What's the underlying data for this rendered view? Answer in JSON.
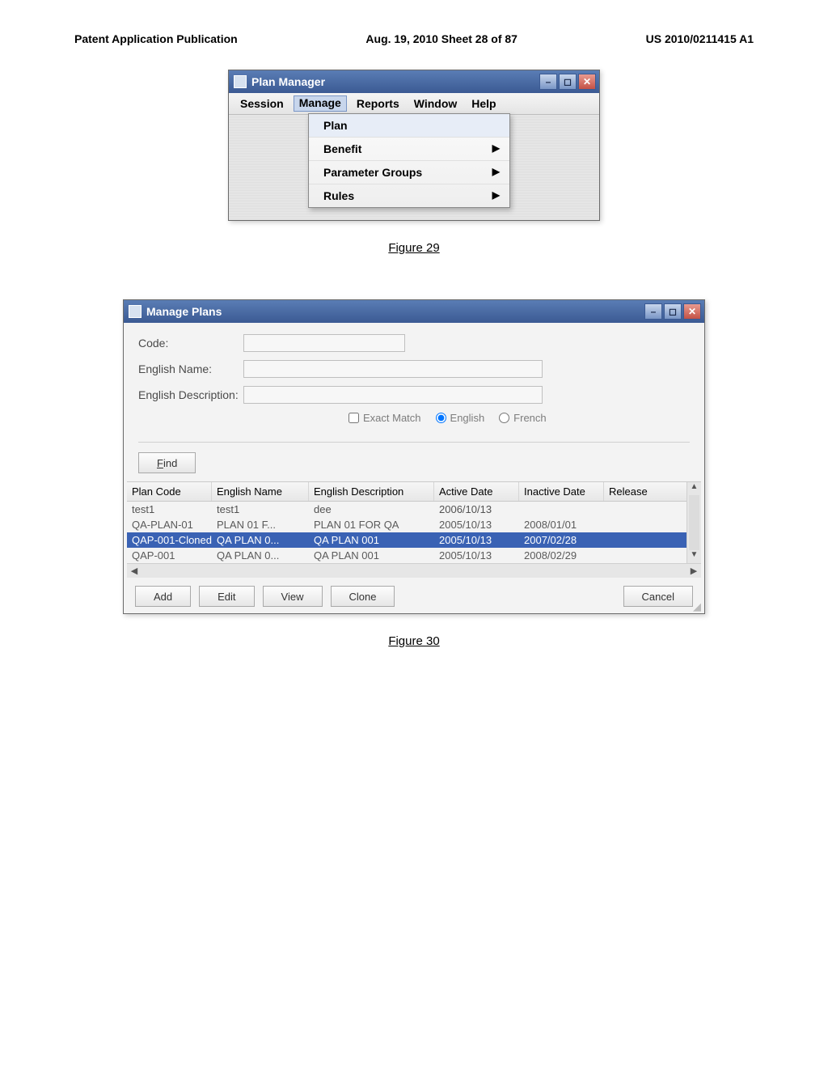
{
  "page_header": {
    "left": "Patent Application Publication",
    "center": "Aug. 19, 2010  Sheet 28 of 87",
    "right": "US 2010/0211415 A1"
  },
  "fig29": {
    "title": "Plan Manager",
    "menu": {
      "session": "Session",
      "manage": "Manage",
      "reports": "Reports",
      "window": "Window",
      "help": "Help"
    },
    "dropdown": {
      "plan": "Plan",
      "benefit": "Benefit",
      "param_groups": "Parameter Groups",
      "rules": "Rules"
    },
    "caption": "Figure 29"
  },
  "fig30": {
    "title": "Manage Plans",
    "labels": {
      "code": "Code:",
      "english_name": "English Name:",
      "english_description": "English Description:"
    },
    "options": {
      "exact_match": "Exact Match",
      "english": "English",
      "french": "French"
    },
    "find_label": "Find",
    "columns": {
      "plan_code": "Plan Code",
      "english_name": "English Name",
      "english_description": "English Description",
      "active_date": "Active Date",
      "inactive_date": "Inactive Date",
      "release": "Release"
    },
    "rows": [
      {
        "code": "test1",
        "name": "test1",
        "desc": "dee",
        "active": "2006/10/13",
        "inactive": "",
        "release": ""
      },
      {
        "code": "QA-PLAN-01",
        "name": "PLAN 01 F...",
        "desc": "PLAN 01 FOR QA",
        "active": "2005/10/13",
        "inactive": "2008/01/01",
        "release": ""
      },
      {
        "code": "QAP-001-Cloned",
        "name": "QA PLAN 0...",
        "desc": "QA PLAN 001",
        "active": "2005/10/13",
        "inactive": "2007/02/28",
        "release": ""
      },
      {
        "code": "QAP-001",
        "name": "QA PLAN 0...",
        "desc": "QA PLAN 001",
        "active": "2005/10/13",
        "inactive": "2008/02/29",
        "release": ""
      }
    ],
    "buttons": {
      "add": "Add",
      "edit": "Edit",
      "view": "View",
      "clone": "Clone",
      "cancel": "Cancel"
    },
    "caption": "Figure 30"
  }
}
